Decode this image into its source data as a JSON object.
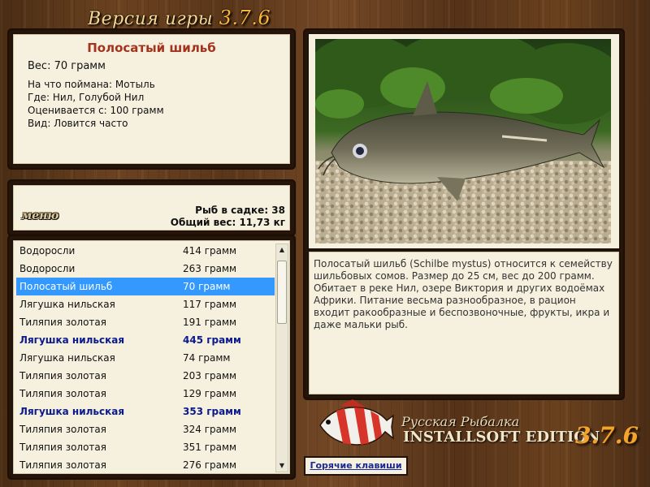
{
  "header": {
    "version_label": "Версия игры",
    "version_number": "3.7.6"
  },
  "fish_info": {
    "name": "Полосатый шильб",
    "weight": "Вес: 70 грамм",
    "bait": "На что поймана: Мотыль",
    "location": "Где: Нил, Голубой Нил",
    "value_threshold": "Оценивается с: 100 грамм",
    "frequency": "Вид: Ловится часто"
  },
  "keeper": {
    "menu_label": "меню",
    "fish_count": "Рыб в садке: 38",
    "total_weight": "Общий вес: 11,73 кг"
  },
  "catch_list": [
    {
      "name": "Водоросли",
      "weight": "414 грамм"
    },
    {
      "name": "Водоросли",
      "weight": "263 грамм"
    },
    {
      "name": "Полосатый шильб",
      "weight": "70 грамм",
      "selected": true
    },
    {
      "name": "Лягушка нильская",
      "weight": "117 грамм"
    },
    {
      "name": "Тиляпия золотая",
      "weight": "191 грамм"
    },
    {
      "name": "Лягушка нильская",
      "weight": "445 грамм",
      "highlight": true
    },
    {
      "name": "Лягушка нильская",
      "weight": "74 грамм"
    },
    {
      "name": "Тиляпия золотая",
      "weight": "203 грамм"
    },
    {
      "name": "Тиляпия золотая",
      "weight": "129 грамм"
    },
    {
      "name": "Лягушка нильская",
      "weight": "353 грамм",
      "highlight": true
    },
    {
      "name": "Тиляпия золотая",
      "weight": "324 грамм"
    },
    {
      "name": "Тиляпия золотая",
      "weight": "351 грамм"
    },
    {
      "name": "Тиляпия золотая",
      "weight": "276 грамм"
    }
  ],
  "description": "Полосатый шильб (Schilbe mystus) относится к семейству шильбовых сомов. Размер до 25 см, вес до 200 грамм. Обитает в реке Нил, озере Виктория и других водоёмах Африки. Питание весьма разнообразное, в рацион входит ракообразные и беспозвоночные, фрукты, икра и даже мальки рыб.",
  "logo": {
    "title": "Русская Рыбалка",
    "edition": "INSTALLSOFT EDITION",
    "version": "3.7.6"
  },
  "hotkeys_label": "Горячие клавиши",
  "colors": {
    "accent_selected": "#3399ff",
    "highlight_text": "#0a1a8c",
    "title_red": "#a3331c"
  }
}
